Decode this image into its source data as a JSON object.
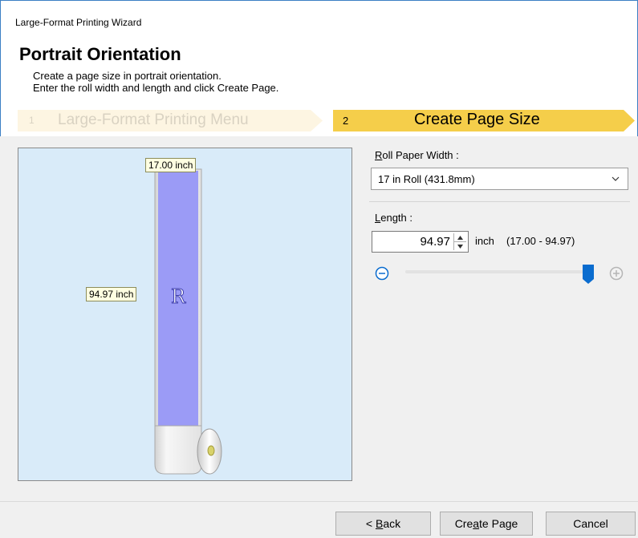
{
  "window": {
    "title": "Large-Format Printing Wizard"
  },
  "header": {
    "heading": "Portrait Orientation",
    "desc_line1": "Create a page size in portrait orientation.",
    "desc_line2": "Enter the roll width and length and click Create Page."
  },
  "steps": [
    {
      "number": "1",
      "label": "Large-Format Printing Menu",
      "active": false
    },
    {
      "number": "2",
      "label": "Create Page Size",
      "active": true
    }
  ],
  "preview": {
    "width_label": "17.00 inch",
    "length_label": "94.97 inch",
    "page_glyph": "R",
    "colors": {
      "background": "#d9ebf9",
      "page": "#9b9bf6",
      "tooltip": "#ffffe1"
    }
  },
  "roll_width": {
    "label_accel": "R",
    "label_rest": "oll Paper Width :",
    "selected": "17 in Roll (431.8mm)"
  },
  "length": {
    "label_accel": "L",
    "label_rest": "ength :",
    "value": "94.97",
    "unit": "inch",
    "range": "(17.00 - 94.97)",
    "slider_level": 1.0
  },
  "buttons": {
    "back_pre": "< ",
    "back_accel": "B",
    "back_rest": "ack",
    "create_pre": "Cre",
    "create_accel": "a",
    "create_rest": "te Page",
    "cancel": "Cancel"
  },
  "icons": [
    "chevron-down-icon",
    "spin-up-icon",
    "spin-down-icon",
    "zoom-out-icon",
    "zoom-in-icon",
    "slider-thumb-icon",
    "roll-core-icon"
  ],
  "colors": {
    "accent": "#0a6ccf",
    "step_active": "#f5ce4a",
    "step_inactive": "#fdf5e2"
  }
}
